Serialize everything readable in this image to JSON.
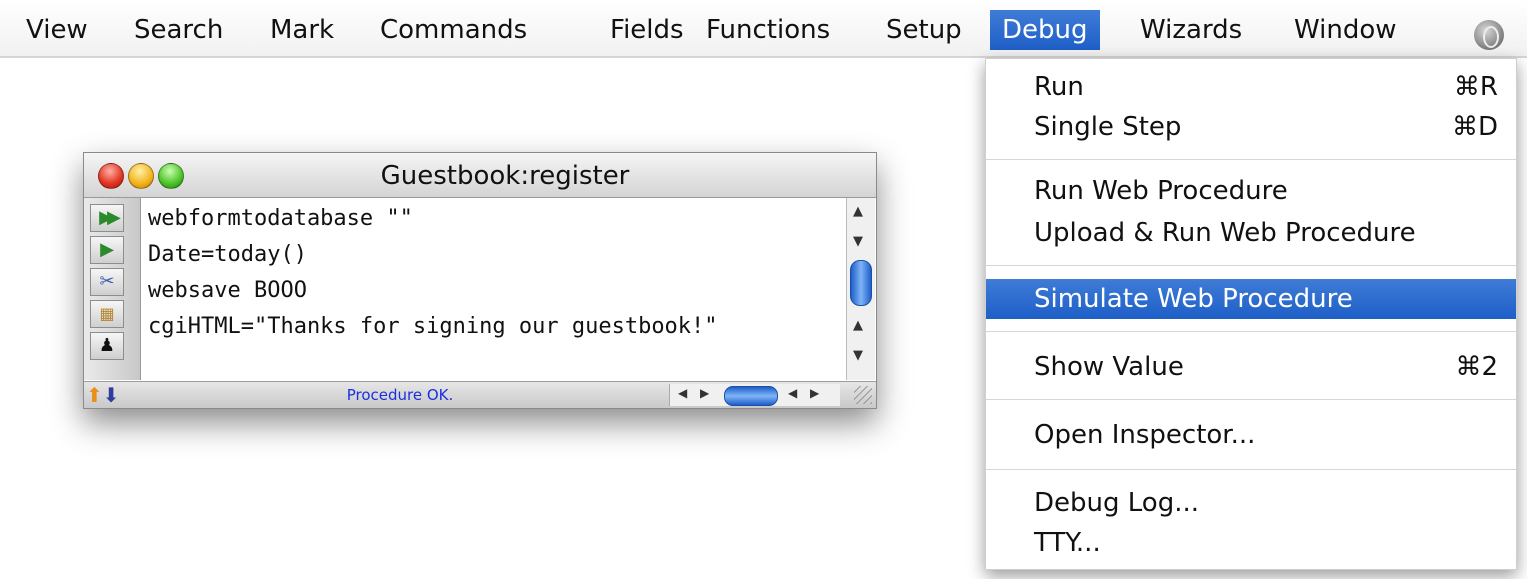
{
  "menubar": {
    "items": [
      "View",
      "Search",
      "Mark",
      "Commands",
      "Fields",
      "Functions",
      "Setup",
      "Debug",
      "Wizards",
      "Window"
    ],
    "active": "Debug",
    "extra_icon": "globe-icon"
  },
  "window": {
    "title": "Guestbook:register",
    "tool_icons": [
      "run-all-icon",
      "run-icon",
      "scissors-icon",
      "procedure-icon",
      "stamp-icon"
    ],
    "code_lines": [
      "webformtodatabase \"\"",
      "Date=today()",
      "websave BOOO",
      "cgiHTML=\"Thanks for signing our guestbook!\""
    ],
    "status": "Procedure OK."
  },
  "debug_menu": {
    "sections": [
      [
        {
          "label": "Run",
          "shortcut": "⌘R"
        },
        {
          "label": "Single Step",
          "shortcut": "⌘D"
        }
      ],
      [
        {
          "label": "Run Web Procedure",
          "shortcut": ""
        },
        {
          "label": "Upload & Run Web Procedure",
          "shortcut": ""
        }
      ],
      [
        {
          "label": "Simulate Web Procedure",
          "shortcut": "",
          "highlighted": true
        }
      ],
      [
        {
          "label": "Show Value",
          "shortcut": "⌘2"
        }
      ],
      [
        {
          "label": "Open Inspector...",
          "shortcut": ""
        }
      ],
      [
        {
          "label": "Debug Log...",
          "shortcut": ""
        },
        {
          "label": "TTY...",
          "shortcut": ""
        }
      ]
    ]
  },
  "colors": {
    "highlight": "#2a6ad0",
    "status_text": "#1b2fe0"
  }
}
